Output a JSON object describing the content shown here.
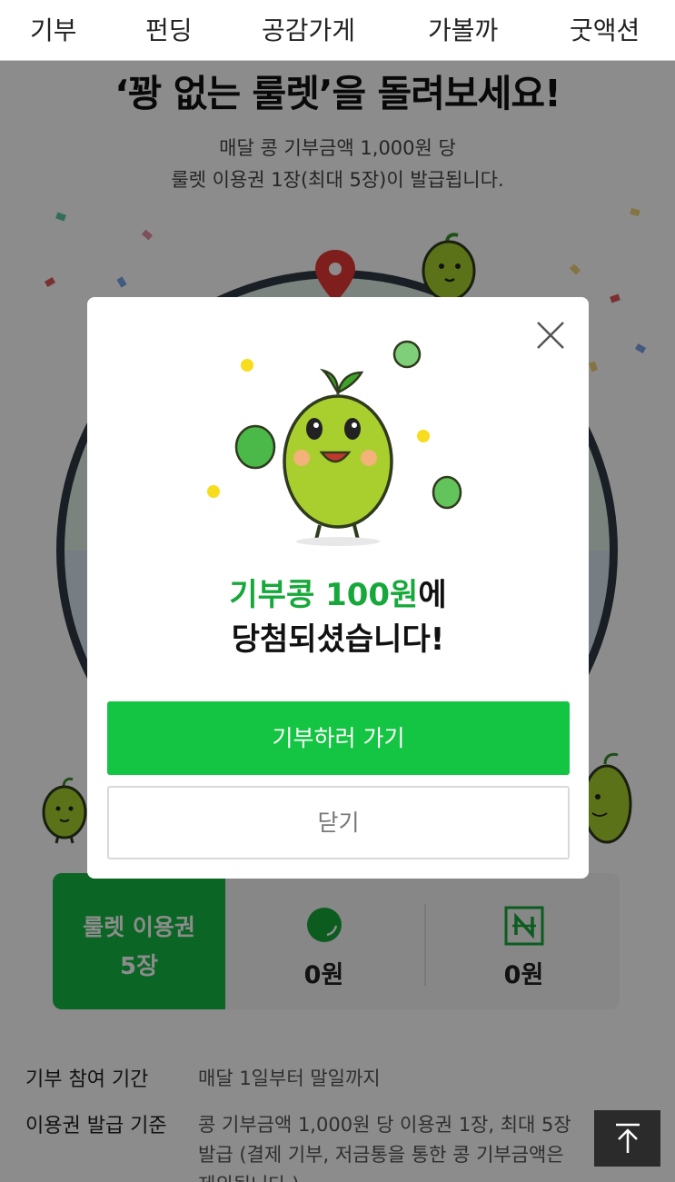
{
  "nav": {
    "items": [
      {
        "label": "기부"
      },
      {
        "label": "펀딩"
      },
      {
        "label": "공감가게"
      },
      {
        "label": "가볼까"
      },
      {
        "label": "굿액션"
      }
    ]
  },
  "promo": {
    "headline": "‘꽝 없는 룰렛’을 돌려보세요!",
    "desc_line1": "매달 콩 기부금액 1,000원 당",
    "desc_line2": "룰렛 이용권 1장(최대 5장)이 발급됩니다."
  },
  "stats": {
    "ticket_label": "룰렛 이용권",
    "ticket_count": "5장",
    "bean_amount": "0원",
    "npay_amount": "0원"
  },
  "info": {
    "period_label": "기부 참여 기간",
    "period_value": "매달 1일부터 말일까지",
    "criteria_label": "이용권 발급 기준",
    "criteria_line1": "콩 기부금액 1,000원 당 이용권 1장, 최대 5장",
    "criteria_line2": "발급 (결제 기부, 저금통을 통한 콩 기부금액은",
    "criteria_line3": "제외됩니다.)"
  },
  "modal": {
    "result_highlight": "기부콩 100원",
    "result_suffix": "에",
    "result_line2": "당첨되셨습니다!",
    "primary_label": "기부하러 가기",
    "secondary_label": "닫기"
  },
  "colors": {
    "brand_green": "#14c443",
    "highlight_green": "#17a83b"
  }
}
